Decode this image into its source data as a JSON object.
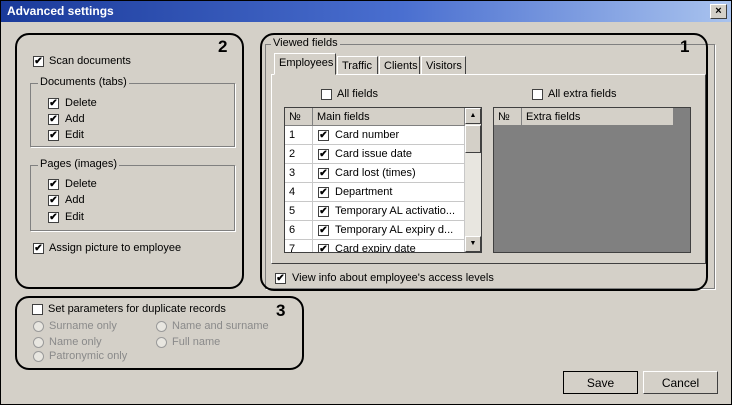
{
  "window": {
    "title": "Advanced settings",
    "close_glyph": "×"
  },
  "scan": {
    "scan_documents": "Scan documents",
    "documents_group": "Documents (tabs)",
    "documents_items": [
      "Delete",
      "Add",
      "Edit"
    ],
    "pages_group": "Pages (images)",
    "pages_items": [
      "Delete",
      "Add",
      "Edit"
    ],
    "assign_picture": "Assign picture to employee"
  },
  "viewed": {
    "group": "Viewed fields",
    "tabs": [
      "Employees",
      "Traffic",
      "Clients",
      "Visitors"
    ],
    "all_fields": "All fields",
    "all_extra_fields": "All extra fields",
    "main_table": {
      "col_num": "№",
      "col_name": "Main fields",
      "rows": [
        {
          "n": "1",
          "label": "Card number"
        },
        {
          "n": "2",
          "label": "Card issue date"
        },
        {
          "n": "3",
          "label": "Card lost (times)"
        },
        {
          "n": "4",
          "label": "Department"
        },
        {
          "n": "5",
          "label": "Temporary AL activatio..."
        },
        {
          "n": "6",
          "label": "Temporary AL expiry d..."
        },
        {
          "n": "7",
          "label": "Card expiry date"
        }
      ]
    },
    "extra_table": {
      "col_num": "№",
      "col_name": "Extra fields"
    },
    "view_access": "View info about employee's access levels"
  },
  "duplicate": {
    "set_params": "Set parameters for duplicate records",
    "options": [
      "Surname only",
      "Name and surname",
      "Name only",
      "Full name",
      "Patronymic only"
    ]
  },
  "annotations": [
    "1",
    "2",
    "3"
  ],
  "check_glyph": "✔",
  "scroll_up_glyph": "▲",
  "scroll_down_glyph": "▼",
  "buttons": {
    "save": "Save",
    "cancel": "Cancel"
  }
}
